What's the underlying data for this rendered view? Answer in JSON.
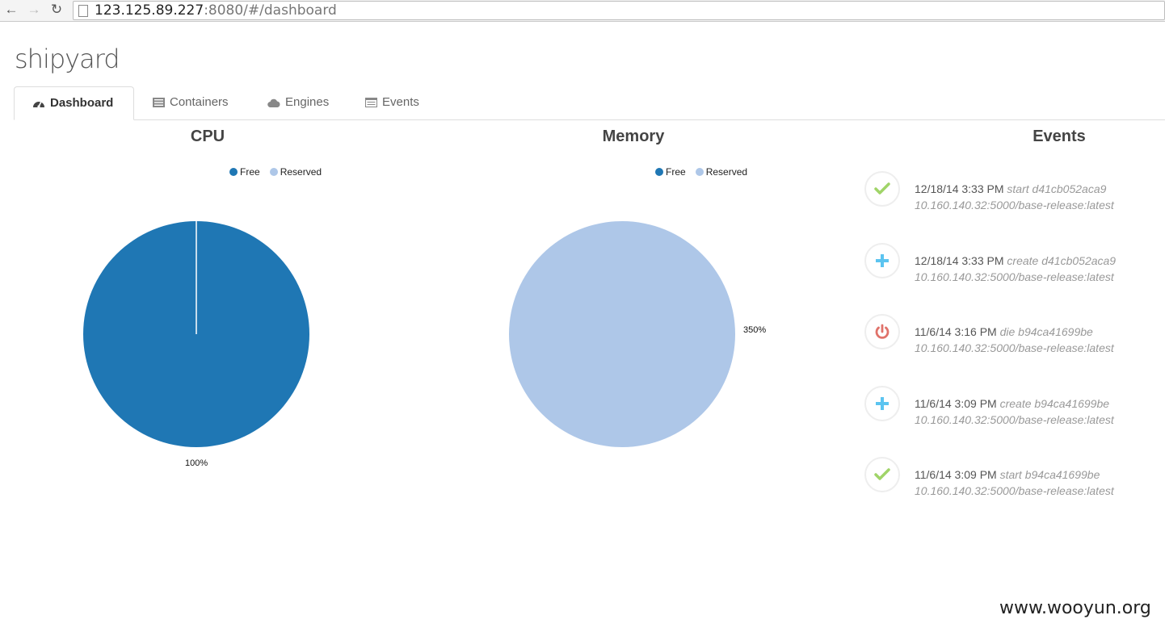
{
  "browser": {
    "url_host": "123.125.89.227",
    "url_rest": ":8080/#/dashboard",
    "back_icon": "←",
    "forward_icon": "→",
    "reload_icon": "↻"
  },
  "app": {
    "logo": "shipyard",
    "tabs": [
      {
        "label": "Dashboard",
        "icon": "dashboard-icon",
        "active": true
      },
      {
        "label": "Containers",
        "icon": "containers-icon",
        "active": false
      },
      {
        "label": "Engines",
        "icon": "cloud-icon",
        "active": false
      },
      {
        "label": "Events",
        "icon": "list-icon",
        "active": false
      }
    ]
  },
  "colors": {
    "free": "#1f77b4",
    "reserved": "#aec7e8",
    "start": "#a0d468",
    "create": "#5cc4f0",
    "die": "#e0726a"
  },
  "chart_data": [
    {
      "type": "pie",
      "title": "CPU",
      "legend": [
        "Free",
        "Reserved"
      ],
      "legend_position": "top",
      "series": [
        {
          "name": "Free",
          "value": 100
        },
        {
          "name": "Reserved",
          "value": 0
        }
      ],
      "labels": [
        "100%"
      ]
    },
    {
      "type": "pie",
      "title": "Memory",
      "legend": [
        "Free",
        "Reserved"
      ],
      "legend_position": "top",
      "series": [
        {
          "name": "Free",
          "value": 0
        },
        {
          "name": "Reserved",
          "value": 100
        }
      ],
      "labels": [
        "350%"
      ]
    }
  ],
  "events": {
    "title": "Events",
    "items": [
      {
        "type": "start",
        "icon": "check-icon",
        "time": "12/18/14 3:33 PM",
        "desc": "start d41cb052aca9",
        "image": "10.160.140.32:5000/base-release:latest"
      },
      {
        "type": "create",
        "icon": "plus-icon",
        "time": "12/18/14 3:33 PM",
        "desc": "create d41cb052aca9",
        "image": "10.160.140.32:5000/base-release:latest"
      },
      {
        "type": "die",
        "icon": "power-icon",
        "time": "11/6/14 3:16 PM",
        "desc": "die b94ca41699be",
        "image": "10.160.140.32:5000/base-release:latest"
      },
      {
        "type": "create",
        "icon": "plus-icon",
        "time": "11/6/14 3:09 PM",
        "desc": "create b94ca41699be",
        "image": "10.160.140.32:5000/base-release:latest"
      },
      {
        "type": "start",
        "icon": "check-icon",
        "time": "11/6/14 3:09 PM",
        "desc": "start b94ca41699be",
        "image": "10.160.140.32:5000/base-release:latest"
      }
    ]
  },
  "watermark": "www.wooyun.org"
}
